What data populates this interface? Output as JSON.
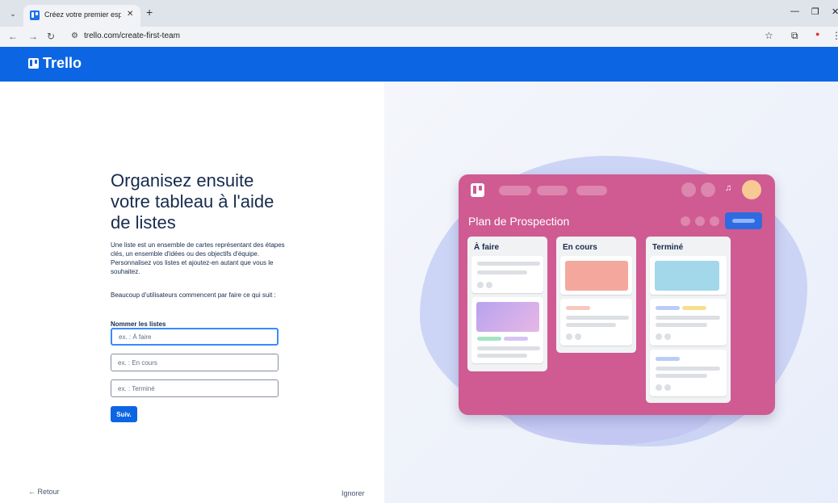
{
  "browser": {
    "tab_title": "Créez votre premier espace de",
    "url": "trello.com/create-first-team"
  },
  "header": {
    "logo_text": "Trello",
    "brand_color": "#0c66e4"
  },
  "form": {
    "heading": "Organisez ensuite votre tableau à l'aide de listes",
    "paragraph1": "Une liste est un ensemble de cartes représentant des étapes clés, un ensemble d'idées ou des objectifs d'équipe. Personnalisez vos listes et ajoutez-en autant que vous le souhaitez.",
    "paragraph2": "Beaucoup d'utilisateurs commencent par faire ce qui suit :",
    "field_label": "Nommer les listes",
    "fields": [
      {
        "placeholder": "ex. : À faire",
        "value": ""
      },
      {
        "placeholder": "ex. : En cours",
        "value": ""
      },
      {
        "placeholder": "ex. : Terminé",
        "value": ""
      }
    ],
    "next_label": "Suiv."
  },
  "footer": {
    "back_label": "← Retour",
    "skip_label": "Ignorer"
  },
  "illustration": {
    "board_title": "Plan de Prospection",
    "board_color": "#cf5b92",
    "lists": [
      {
        "title": "À faire"
      },
      {
        "title": "En cours"
      },
      {
        "title": "Terminé"
      }
    ]
  }
}
